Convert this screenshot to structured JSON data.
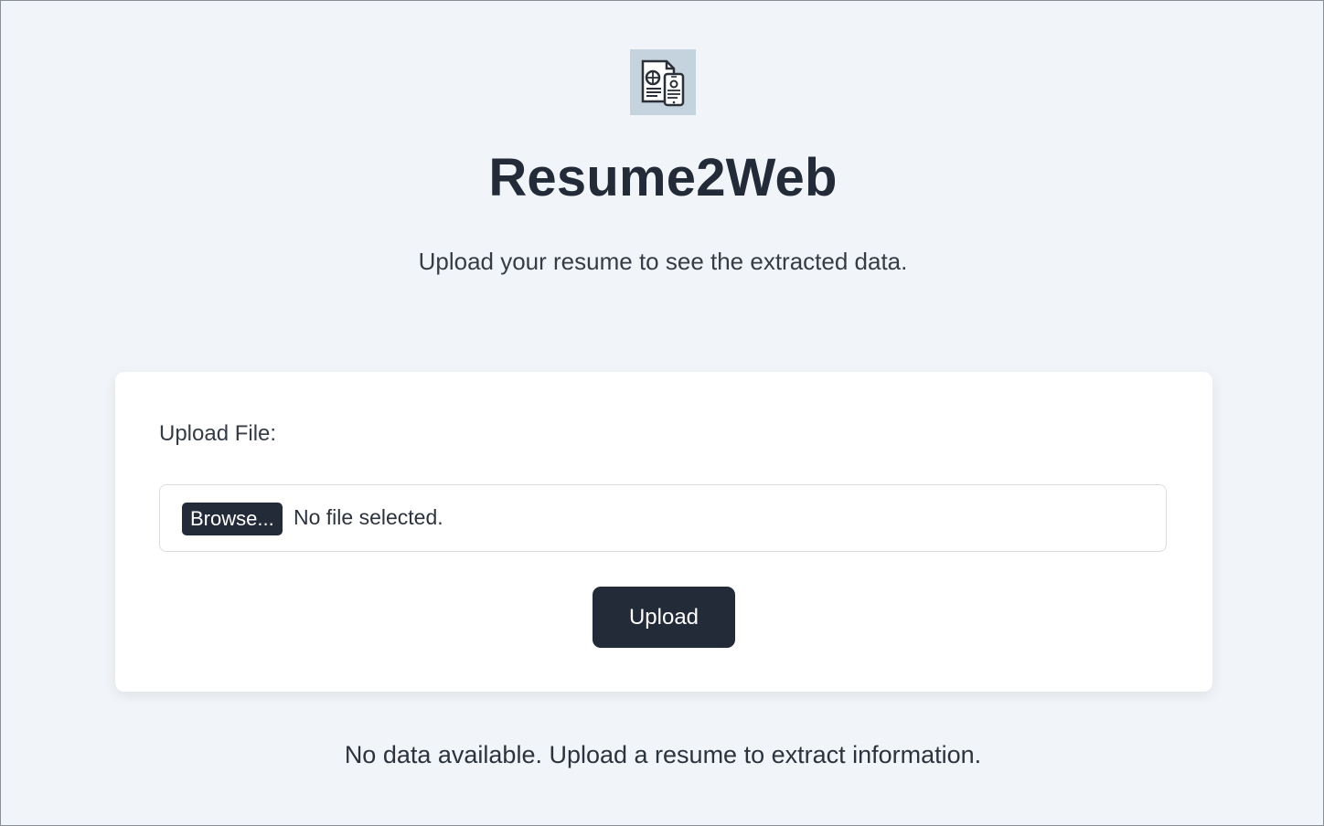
{
  "app": {
    "logo_icon": "resume-to-phone-icon",
    "title": "Resume2Web",
    "subtitle": "Upload your resume to see the extracted data."
  },
  "upload_form": {
    "label": "Upload File:",
    "browse_label": "Browse...",
    "file_status": "No file selected.",
    "submit_label": "Upload"
  },
  "results": {
    "empty_message": "No data available. Upload a resume to extract information."
  },
  "colors": {
    "background": "#f1f4f8",
    "primary": "#232b38",
    "card": "#ffffff",
    "logo_background": "#c5d3df"
  }
}
